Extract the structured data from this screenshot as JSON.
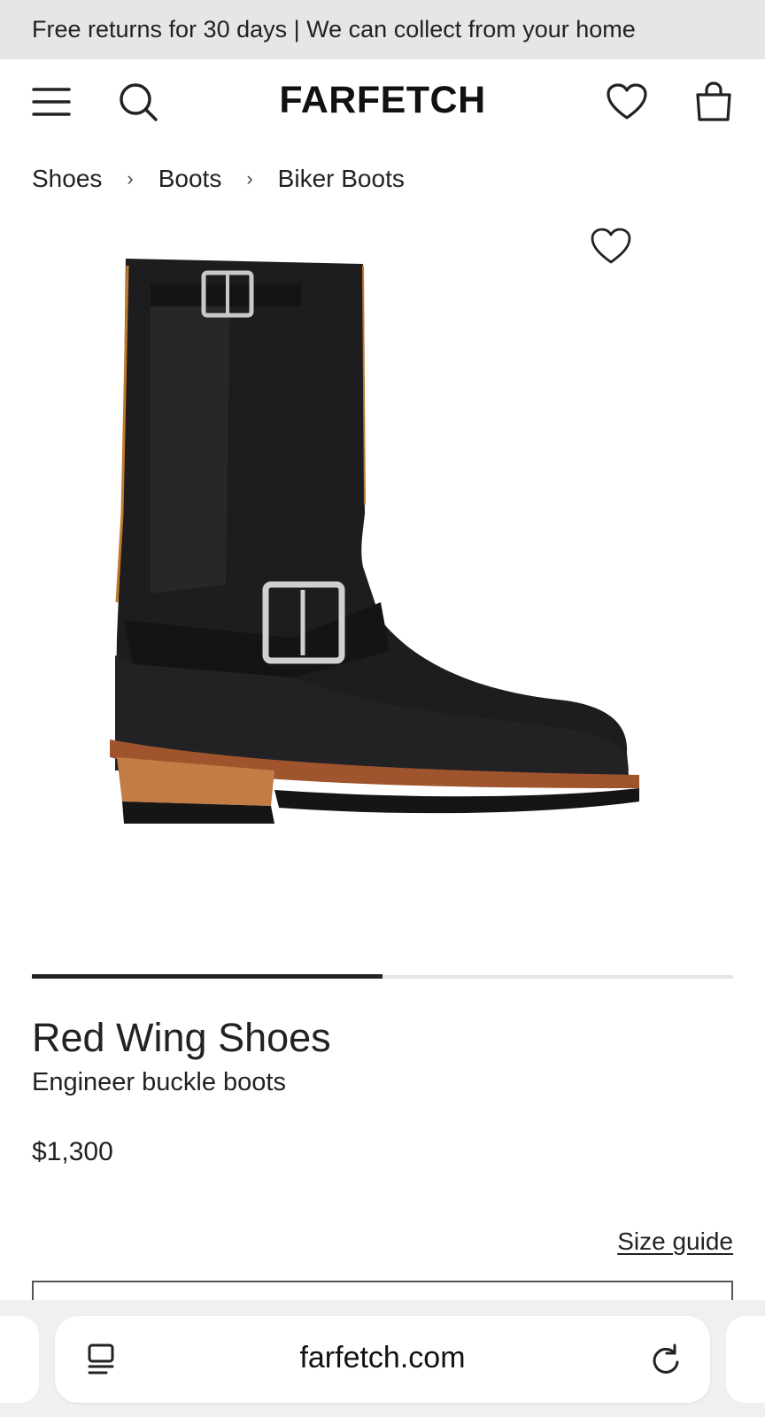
{
  "promo": {
    "text": "Free returns for 30 days | We can collect from your home"
  },
  "header": {
    "logo": "FARFETCH",
    "icons": [
      "menu-icon",
      "search-icon",
      "heart-icon",
      "shopping-bag-icon"
    ]
  },
  "breadcrumb": {
    "items": [
      {
        "label": "Shoes"
      },
      {
        "label": "Boots"
      },
      {
        "label": "Biker Boots"
      }
    ],
    "separator": "›"
  },
  "product": {
    "brand": "Red Wing Shoes",
    "name": "Engineer buckle boots",
    "price": "$1,300",
    "size_guide_label": "Size guide",
    "carousel_progress": 0.5,
    "image_icon": "boot-image"
  },
  "browser": {
    "url": "farfetch.com",
    "icons": [
      "reader-icon",
      "reload-icon"
    ]
  },
  "colors": {
    "promo_bg": "#e6e6e6",
    "text": "#222222",
    "browser_bg": "#f0f0f0"
  }
}
